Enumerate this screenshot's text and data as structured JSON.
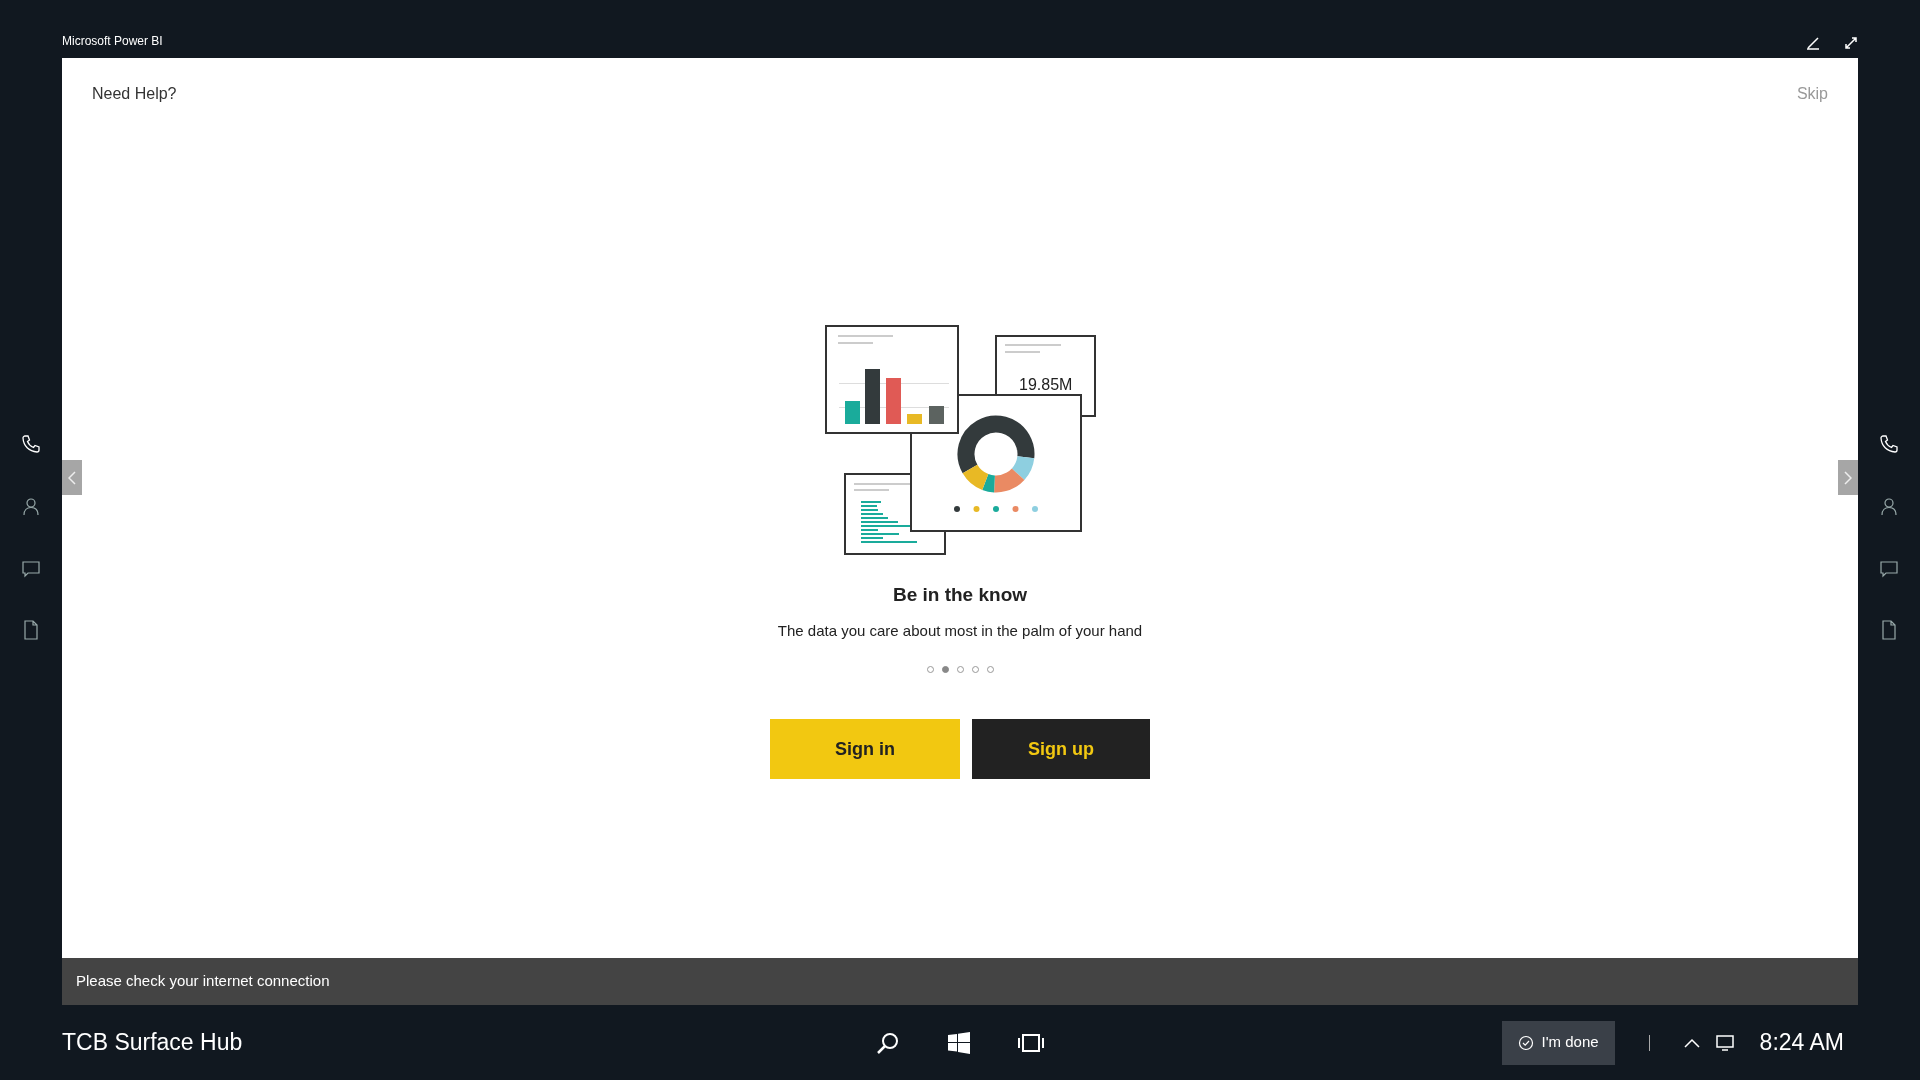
{
  "window": {
    "title": "Microsoft Power BI"
  },
  "header": {
    "help_link": "Need Help?",
    "skip_link": "Skip"
  },
  "illustration": {
    "kpi_value": "19.85M"
  },
  "slide": {
    "title": "Be in the know",
    "subtitle": "The data you care about most in the palm of your hand"
  },
  "pager": [
    {
      "selected": false
    },
    {
      "selected": true
    },
    {
      "selected": false
    },
    {
      "selected": false
    },
    {
      "selected": false
    }
  ],
  "buttons": [
    {
      "label": "Sign in",
      "kind": "primary"
    },
    {
      "label": "Sign up",
      "kind": "secondary"
    }
  ],
  "status_bar": {
    "message": "Please check your internet connection"
  },
  "taskbar": {
    "device_name": "TCB Surface Hub",
    "done_button": "I'm done",
    "clock": "8:24 AM"
  }
}
